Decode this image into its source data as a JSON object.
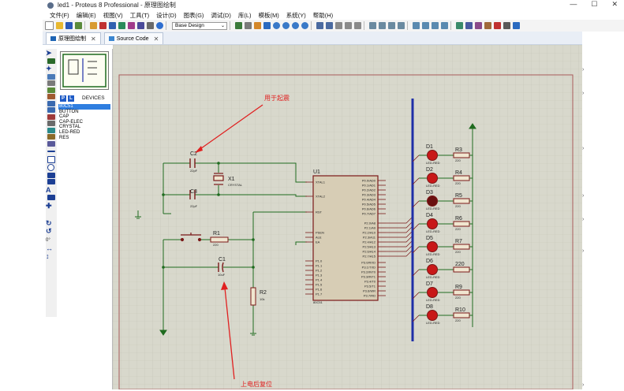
{
  "window": {
    "title": "led1 - Proteus 8 Professional - 原理图绘制",
    "min_label": "—",
    "max_label": "☐",
    "close_label": "✕"
  },
  "menu": [
    "文件(F)",
    "编辑(E)",
    "视图(V)",
    "工具(T)",
    "设计(D)",
    "图表(G)",
    "调试(D)",
    "库(L)",
    "模板(M)",
    "系统(Y)",
    "帮助(H)"
  ],
  "toolbar": {
    "design_select_value": "Base Design",
    "icons": [
      "new-file-icon",
      "open-folder-icon",
      "save-icon",
      "import-icon",
      "home-icon",
      "component-icon",
      "isis-icon",
      "pcb-icon",
      "gerber-icon",
      "code-icon",
      "bom-icon",
      "help-icon"
    ]
  },
  "tabs": [
    {
      "label": "原理图绘制",
      "close": "✕"
    },
    {
      "label": "Source Code",
      "close": "✕"
    }
  ],
  "device_panel": {
    "p_button": "P",
    "l_button": "L",
    "title": "DEVICES",
    "items": [
      "80C51",
      "BUTTON",
      "CAP",
      "CAP-ELEC",
      "CRYSTAL",
      "LED-RED",
      "RES"
    ],
    "selected": "80C51"
  },
  "left_tools": {
    "label_tool": "A",
    "hint_zero": "0°"
  },
  "schematic": {
    "annotation_oscillation": "用于起震",
    "annotation_reset": "上电后复位",
    "crystal": {
      "ref": "X1",
      "value": "CRYSTAL"
    },
    "cap_c2": {
      "ref": "C2",
      "value": "22pF"
    },
    "cap_c3": {
      "ref": "C3",
      "value": "22pF"
    },
    "cap_c1": {
      "ref": "C1",
      "value": "10uF"
    },
    "res_r1": {
      "ref": "R1",
      "value": "220"
    },
    "res_r2": {
      "ref": "R2",
      "value": "10k"
    },
    "mcu": {
      "ref": "U1",
      "part": "80C51"
    },
    "mcu_left_pins": [
      "XTAL1",
      "XTAL2",
      "RST",
      "PSEN",
      "ALE",
      "EA",
      "P1.0",
      "P1.1",
      "P1.2",
      "P1.3",
      "P1.4",
      "P1.5",
      "P1.6",
      "P1.7"
    ],
    "mcu_right_pins_p0": [
      "P0.0/AD0",
      "P0.1/AD1",
      "P0.2/AD2",
      "P0.3/AD3",
      "P0.4/AD4",
      "P0.5/AD5",
      "P0.6/AD6",
      "P0.7/AD7"
    ],
    "mcu_right_pins_p2": [
      "P2.0/A8",
      "P2.1/A9",
      "P2.2/A10",
      "P2.3/A11",
      "P2.4/A12",
      "P2.5/A13",
      "P2.6/A14",
      "P2.7/A15"
    ],
    "mcu_right_pins_p3": [
      "P3.0/RXD",
      "P3.1/TXD",
      "P3.2/INT0",
      "P3.3/INT1",
      "P3.4/T0",
      "P3.5/T1",
      "P3.6/WR",
      "P3.7/RD"
    ],
    "leds": [
      {
        "ref": "D1",
        "type": "LED-RED",
        "res": "R3",
        "res_value": "220"
      },
      {
        "ref": "D2",
        "type": "LED-RED",
        "res": "R4",
        "res_value": "220"
      },
      {
        "ref": "D3",
        "type": "LED-RED",
        "res": "R5",
        "res_value": "220"
      },
      {
        "ref": "D4",
        "type": "LED-RED",
        "res": "R6",
        "res_value": "220"
      },
      {
        "ref": "D5",
        "type": "LED-RED",
        "res": "R7",
        "res_value": "220"
      },
      {
        "ref": "D6",
        "type": "LED-RED",
        "res": "220",
        "res_value": ""
      },
      {
        "ref": "D7",
        "type": "LED-RED",
        "res": "R9",
        "res_value": "220"
      },
      {
        "ref": "D8",
        "type": "LED-RED",
        "res": "R10",
        "res_value": "220"
      }
    ]
  },
  "colors": {
    "canvas": "#d8d8cc",
    "grid": "#c6c6b8",
    "border": "#a85a5a",
    "wire": "#1f6b1f",
    "component": "#7a1818",
    "bus": "#1f2fa8",
    "annotation": "#e02020",
    "led_fill": "#c81818",
    "selection": "#2f7ee0"
  }
}
